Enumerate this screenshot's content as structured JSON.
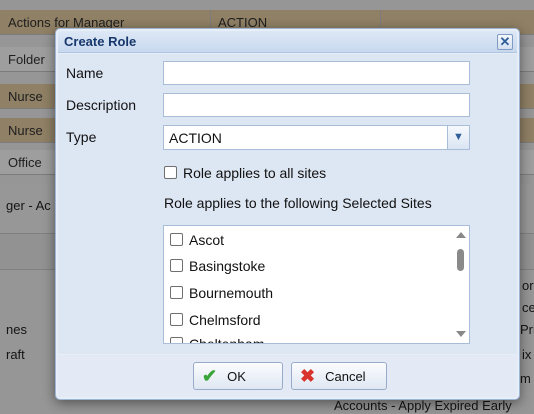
{
  "background": {
    "rows": [
      {
        "col1": "Actions for Manager",
        "col2": "ACTION"
      },
      {
        "col1": "Folder",
        "col2": ""
      },
      {
        "col1": "Nurse",
        "col2": ""
      },
      {
        "col1": "Nurse",
        "col2": ""
      },
      {
        "col1": "Office",
        "col2": ""
      }
    ],
    "section_label": "ger - Ac",
    "left_fragments": [
      "nes",
      "raft"
    ],
    "right_fragments": [
      "or",
      "ce",
      "Pri",
      "ix",
      "m"
    ],
    "bottom_fragment": "Accounts - Apply Expired Early"
  },
  "dialog": {
    "title": "Create Role",
    "close_label": "✕",
    "name_label": "Name",
    "name_value": "",
    "description_label": "Description",
    "description_value": "",
    "type_label": "Type",
    "type_value": "ACTION",
    "all_sites_label": "Role applies to all sites",
    "selected_sites_caption": "Role applies to the following Selected Sites",
    "sites": [
      "Ascot",
      "Basingstoke",
      "Bournemouth",
      "Chelmsford",
      "Cheltenham"
    ],
    "ok_label": "OK",
    "cancel_label": "Cancel"
  },
  "icons": {
    "ok": "check-icon",
    "cancel": "x-icon",
    "select": "chevron-down-icon"
  }
}
